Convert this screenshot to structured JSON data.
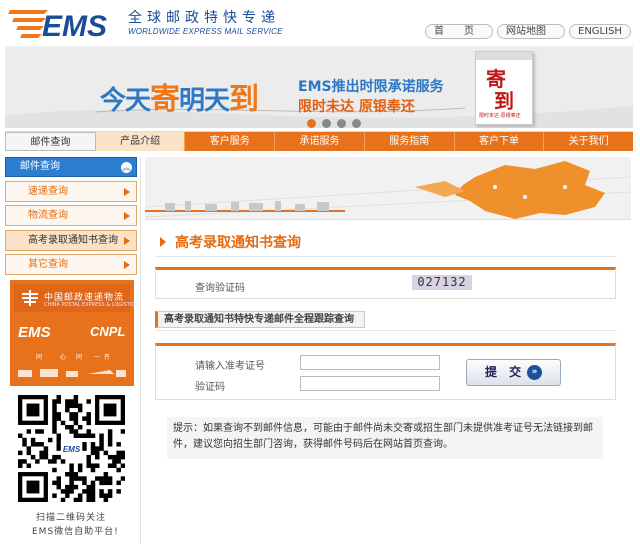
{
  "header": {
    "logo_text": "EMS",
    "brand_cn": "全球邮政特快专递",
    "brand_en": "WORLDWIDE EXPRESS MAIL SERVICE",
    "links": [
      "首　　页",
      "网站地图",
      "ENGLISH"
    ]
  },
  "banner": {
    "slogan_a": "今天",
    "slogan_b": "寄",
    "slogan_c": "明天",
    "slogan_d": "到",
    "line1": "EMS推出时限承诺服务",
    "line2": "限时未达  原银奉还",
    "cal_big1": "寄",
    "cal_big2": "到",
    "cal_small": "限时未达·原银奉还"
  },
  "nav": {
    "tabs": [
      "邮件查询",
      "产品介绍",
      "客户服务",
      "承诺服务",
      "服务指南",
      "客户下单",
      "关于我们"
    ]
  },
  "sidebar": {
    "header": "邮件查询",
    "items": [
      "速递查询",
      "物流查询",
      "高考录取通知书查询",
      "其它查询"
    ],
    "ad": {
      "post_cn": "中国邮政速递物流",
      "post_en": "CHINA POSTAL EXPRESS & LOGISTICS",
      "ems": "EMS",
      "cnpl": "CNPL",
      "strip_left": "同",
      "strip_mid": "心",
      "strip_mid2": "同",
      "strip_right": "一 齐"
    },
    "qr_caption1": "扫描二维码关注",
    "qr_caption2": "EMS微信自助平台!"
  },
  "main": {
    "title": "高考录取通知书查询",
    "verify_label": "查询验证码",
    "captcha": "027132",
    "subtitle": "高考录取通知书特快专递邮件全程跟踪查询",
    "exam_label": "请输入准考证号",
    "code_label": "验证码",
    "exam_value": "",
    "code_value": "",
    "submit_label": "提 交",
    "tip": "提示：如果查询不到邮件信息，可能由于邮件尚未交寄或招生部门未提供准考证号无法链接到邮件，建议您向招生部门咨询，获得邮件号码后在网站首页查询。"
  },
  "colors": {
    "accent": "#e8721c",
    "blue": "#2c7fd0",
    "title": "#e56a10"
  }
}
